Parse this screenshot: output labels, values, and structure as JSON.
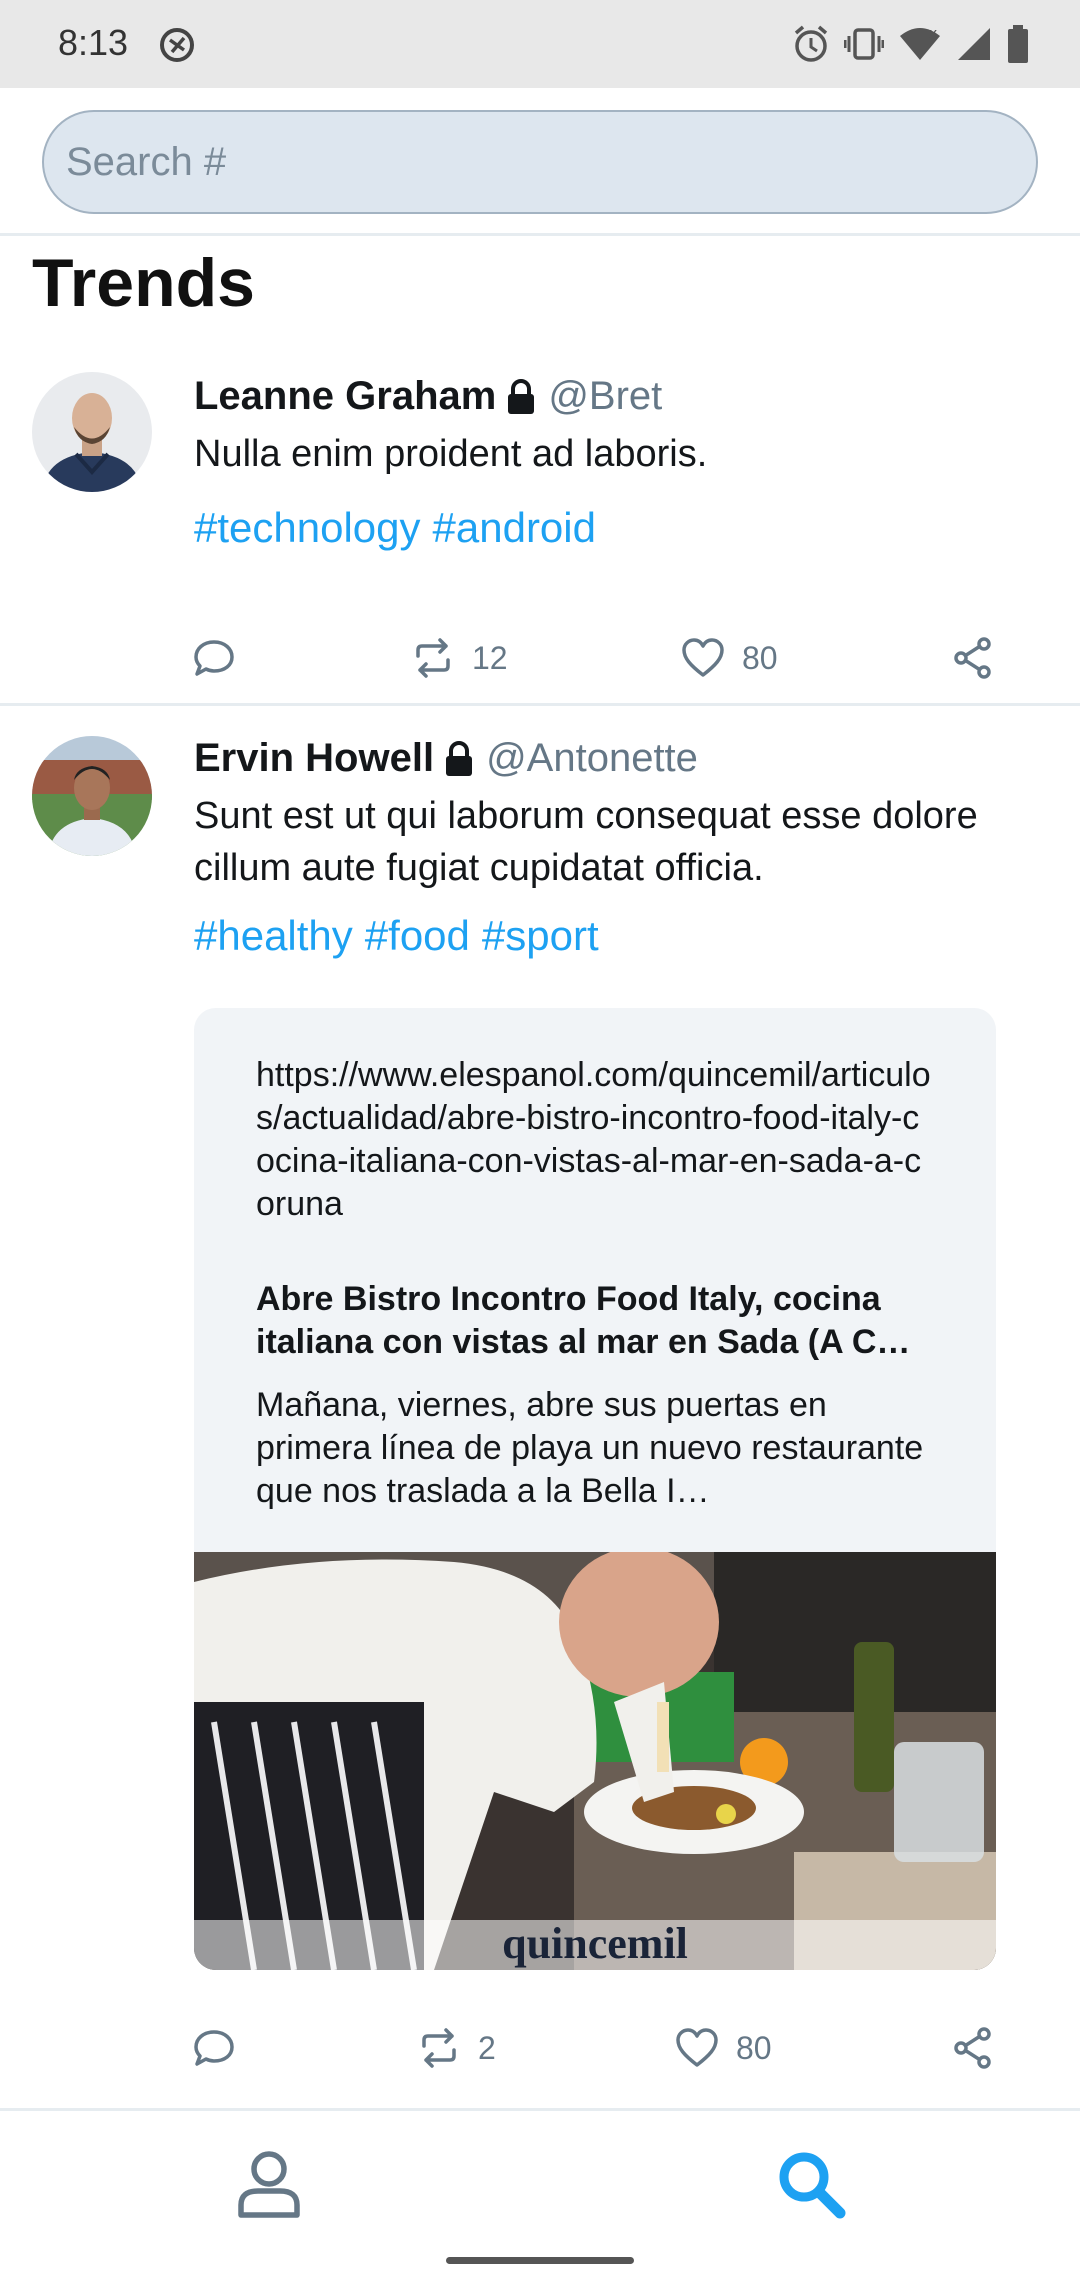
{
  "status_bar": {
    "time": "8:13",
    "icons": [
      "no-disturb-icon",
      "alarm-icon",
      "vibrate-icon",
      "wifi-icon",
      "signal-icon",
      "battery-icon"
    ]
  },
  "search": {
    "placeholder": "Search #",
    "value": ""
  },
  "page": {
    "title": "Trends"
  },
  "tweets": [
    {
      "name": "Leanne Graham",
      "handle": "@Bret",
      "locked": true,
      "text": "Nulla enim proident ad laboris.",
      "hashtags": [
        "#technology",
        "#android"
      ],
      "retweets": "12",
      "likes": "80"
    },
    {
      "name": "Ervin Howell",
      "handle": "@Antonette",
      "locked": true,
      "text": "Sunt est ut qui laborum consequat esse dolore cillum aute fugiat cupidatat officia.",
      "hashtags": [
        "#healthy",
        "#food",
        "#sport"
      ],
      "retweets": "2",
      "likes": "80",
      "link_card": {
        "url": "https://www.elespanol.com/quincemil/articulos/actualidad/abre-bistro-incontro-food-italy-cocina-italiana-con-vistas-al-mar-en-sada-a-coruna",
        "title": "Abre Bistro Incontro Food Italy, cocina italiana con vistas al mar en Sada (A C…",
        "description": "Mañana, viernes, abre sus puertas en primera línea de playa un nuevo restaurante que nos traslada a la Bella I…",
        "image_watermark": "quincemil"
      }
    }
  ],
  "bottom_nav": {
    "items": [
      "profile-icon",
      "search-icon"
    ],
    "active": "search-icon"
  },
  "colors": {
    "accent": "#1da1f2",
    "secondary_text": "#657786",
    "search_bg": "#dde6ef",
    "status_bar_bg": "#e8e8e8"
  }
}
